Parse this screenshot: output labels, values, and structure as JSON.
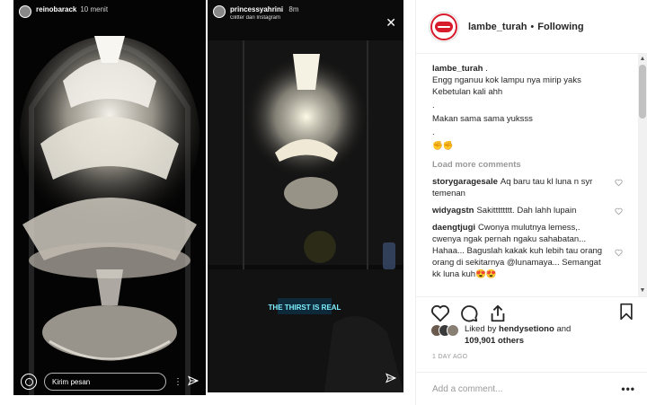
{
  "stories": [
    {
      "username": "reinobarack",
      "time": "10 menit",
      "message_placeholder": "Kirim pesan"
    },
    {
      "username": "princessyahrini",
      "time": "8m",
      "subtitle": "Glitter dari Instagram",
      "neon_text": "THE THIRST IS REAL"
    }
  ],
  "post": {
    "author": "lambe_turah",
    "follow_status": "Following",
    "separator": "•",
    "caption": {
      "user": "lambe_turah",
      "text_first": ".",
      "lines": [
        "Engg nganuu kok lampu nya mirip yaks",
        "Kebetulan kali ahh",
        ".",
        "Makan sama sama yuksss",
        ".",
        "✊✊"
      ]
    },
    "load_more": "Load more comments",
    "comments": [
      {
        "user": "storygaragesale",
        "text": "Aq baru tau kl luna n syr temenan"
      },
      {
        "user": "widyagstn",
        "text": "Sakitttttttt. Dah lahh lupain"
      },
      {
        "user": "daengtjugi",
        "text": "Cwonya mulutnya lemess,. cwenya ngak pernah ngaku sahabatan... Hahaa... Baguslah kakak kuh lebih tau orang orang di sekitarnya @lunamaya... Semangat kk luna kuh😍😍"
      }
    ],
    "likes": {
      "prefix": "Liked by",
      "user": "hendysetiono",
      "and": "and",
      "count": "109,901 others"
    },
    "time_ago": "1 DAY AGO",
    "add_comment_placeholder": "Add a comment...",
    "more_label": "•••"
  },
  "colors": {
    "brand_red": "#d81b2c",
    "text": "#262626",
    "muted": "#999999",
    "border": "#efefef"
  },
  "icons": [
    "camera-icon",
    "send-icon",
    "close-icon",
    "heart-icon",
    "comment-icon",
    "share-icon",
    "bookmark-icon",
    "more-icon"
  ]
}
